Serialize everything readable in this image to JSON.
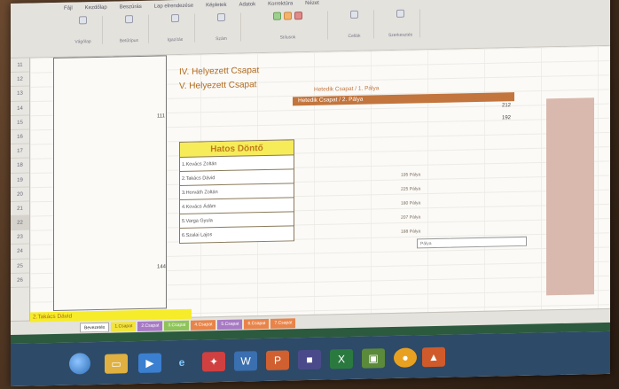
{
  "ribbon": {
    "tabs": [
      "Fájl",
      "Kezdőlap",
      "Beszúrás",
      "Lap elrendezése",
      "Képletek",
      "Adatok",
      "Korrektúra",
      "Nézet"
    ],
    "groups": [
      "Vágólap",
      "Betűtípus",
      "Igazítás",
      "Szám",
      "Stílusok",
      "Cellák",
      "Szerkesztés"
    ]
  },
  "rows": [
    "11",
    "12",
    "13",
    "14",
    "15",
    "16",
    "17",
    "18",
    "19",
    "20",
    "21",
    "22",
    "23",
    "24",
    "25",
    "26"
  ],
  "selected_row": "22",
  "cells": {
    "val_a": "111",
    "val_b": "144",
    "line1": "IV. Helyezett Csapat",
    "line2": "V. Helyezett Csapat",
    "bar1": "Hetedik Csapat / 1. Pálya",
    "bar2": "Hetedik Csapat / 2. Pálya",
    "bar_num1": "212",
    "bar_num2": "192"
  },
  "hatos": {
    "title": "Hatos Döntő",
    "rows": [
      "1.Kovács Zoltán",
      "2.Takács Dávid",
      "3.Horváth Zoltán",
      "4.Kovács Ádám",
      "5.Varga Gyula",
      "6.Szalai Lajos"
    ]
  },
  "side_list": [
    "195 Pálya",
    "225 Pálya",
    "180 Pálya",
    "207 Pálya",
    "188 Pálya"
  ],
  "selected_cell_text": "Pálya",
  "name_box": "2.Takács Dávid",
  "sheet_tabs": [
    {
      "label": "Bevezetés",
      "color": "#ffffff"
    },
    {
      "label": "1.Csapat",
      "color": "#f2e43a"
    },
    {
      "label": "2.Csapat",
      "color": "#a87ac4"
    },
    {
      "label": "3.Csapat",
      "color": "#8fc45a"
    },
    {
      "label": "4.Csapat",
      "color": "#e8844a"
    },
    {
      "label": "5.Csapat",
      "color": "#a87ac4"
    },
    {
      "label": "6.Csapat",
      "color": "#e8844a"
    },
    {
      "label": "7.Csapat",
      "color": "#e8844a"
    }
  ],
  "colors": {
    "accent_orange": "#c2753d",
    "hatos_header": "#f6ec5a",
    "taskbar": "#2d4a68"
  },
  "taskbar_icons": [
    "ie-icon",
    "explorer-icon",
    "media-icon",
    "excel-icon",
    "word-icon",
    "chrome-icon",
    "folder-icon"
  ]
}
